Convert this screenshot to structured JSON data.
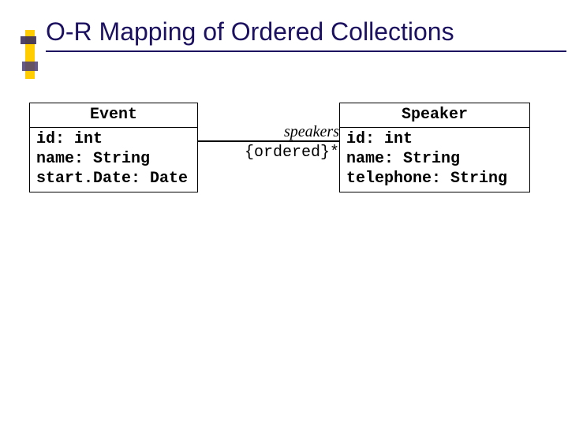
{
  "title": "O-R Mapping of Ordered Collections",
  "classes": {
    "event": {
      "name": "Event",
      "attrs": [
        "id: int",
        "name: String",
        "start.Date: Date"
      ]
    },
    "speaker": {
      "name": "Speaker",
      "attrs": [
        "id: int",
        "name: String",
        "telephone: String"
      ]
    }
  },
  "association": {
    "name": "speakers",
    "constraint": "{ordered}*"
  }
}
